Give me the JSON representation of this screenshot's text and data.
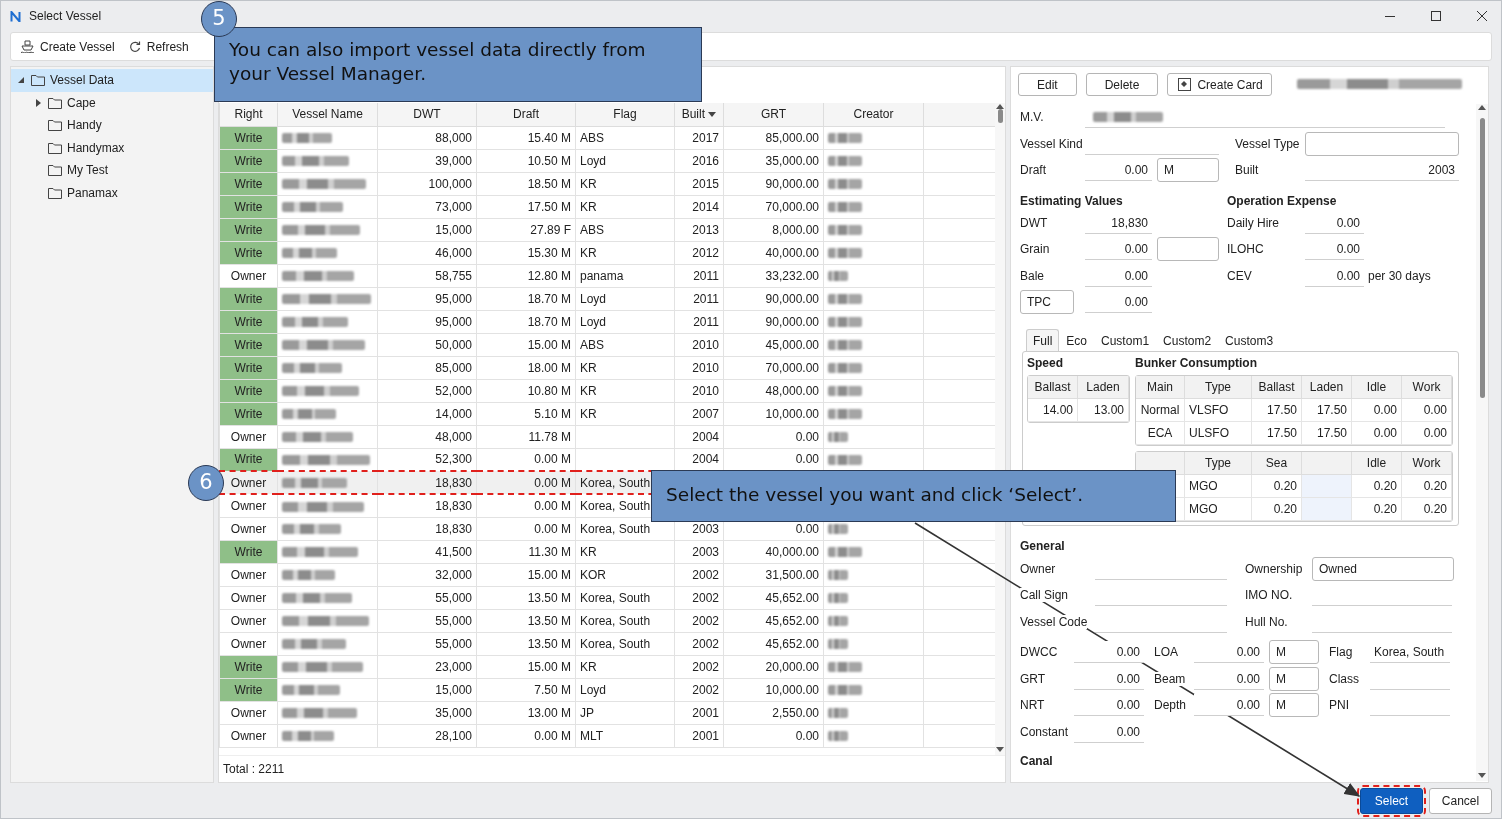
{
  "window": {
    "title": "Select Vessel"
  },
  "toolbar": [
    {
      "label": "Create Vessel",
      "kind": "ship"
    },
    {
      "label": "Refresh",
      "kind": "refresh"
    }
  ],
  "tree": [
    {
      "label": "Vessel Data",
      "selected": true,
      "expanded": true,
      "children": [
        {
          "label": "Cape",
          "selected": false,
          "expanded": false
        },
        {
          "label": "Handy",
          "selected": false
        },
        {
          "label": "Handymax",
          "selected": false
        },
        {
          "label": "My Test",
          "selected": false
        },
        {
          "label": "Panamax",
          "selected": false
        }
      ]
    }
  ],
  "table": {
    "columns": [
      {
        "label": "Right"
      },
      {
        "label": "Vessel Name"
      },
      {
        "label": "DWT"
      },
      {
        "label": "Draft"
      },
      {
        "label": "Flag"
      },
      {
        "label": "Built",
        "sorted": true
      },
      {
        "label": "GRT"
      },
      {
        "label": "Creator"
      }
    ],
    "rows": [
      {
        "right": "Write",
        "kind": "write",
        "dwt": "88,000",
        "draft": "15.40 M",
        "flag": "ABS",
        "built": "2017",
        "grt": "85,000.00",
        "selected": false
      },
      {
        "right": "Write",
        "kind": "write",
        "dwt": "39,000",
        "draft": "10.50 M",
        "flag": "Loyd",
        "built": "2016",
        "grt": "35,000.00",
        "selected": false
      },
      {
        "right": "Write",
        "kind": "write",
        "dwt": "100,000",
        "draft": "18.50 M",
        "flag": "KR",
        "built": "2015",
        "grt": "90,000.00",
        "selected": false
      },
      {
        "right": "Write",
        "kind": "write",
        "dwt": "73,000",
        "draft": "17.50 M",
        "flag": "KR",
        "built": "2014",
        "grt": "70,000.00",
        "selected": false
      },
      {
        "right": "Write",
        "kind": "write",
        "dwt": "15,000",
        "draft": "27.89 F",
        "flag": "ABS",
        "built": "2013",
        "grt": "8,000.00",
        "selected": false
      },
      {
        "right": "Write",
        "kind": "write",
        "dwt": "46,000",
        "draft": "15.30 M",
        "flag": "KR",
        "built": "2012",
        "grt": "40,000.00",
        "selected": false
      },
      {
        "right": "Owner",
        "kind": "owner",
        "dwt": "58,755",
        "draft": "12.80 M",
        "flag": "panama",
        "built": "2011",
        "grt": "33,232.00",
        "selected": false
      },
      {
        "right": "Write",
        "kind": "write",
        "dwt": "95,000",
        "draft": "18.70 M",
        "flag": "Loyd",
        "built": "2011",
        "grt": "90,000.00",
        "selected": false
      },
      {
        "right": "Write",
        "kind": "write",
        "dwt": "95,000",
        "draft": "18.70 M",
        "flag": "Loyd",
        "built": "2011",
        "grt": "90,000.00",
        "selected": false
      },
      {
        "right": "Write",
        "kind": "write",
        "dwt": "50,000",
        "draft": "15.00 M",
        "flag": "ABS",
        "built": "2010",
        "grt": "45,000.00",
        "selected": false
      },
      {
        "right": "Write",
        "kind": "write",
        "dwt": "85,000",
        "draft": "18.00 M",
        "flag": "KR",
        "built": "2010",
        "grt": "70,000.00",
        "selected": false
      },
      {
        "right": "Write",
        "kind": "write",
        "dwt": "52,000",
        "draft": "10.80 M",
        "flag": "KR",
        "built": "2010",
        "grt": "48,000.00",
        "selected": false
      },
      {
        "right": "Write",
        "kind": "write",
        "dwt": "14,000",
        "draft": "5.10 M",
        "flag": "KR",
        "built": "2007",
        "grt": "10,000.00",
        "selected": false
      },
      {
        "right": "Owner",
        "kind": "owner",
        "dwt": "48,000",
        "draft": "11.78 M",
        "built": "2004",
        "grt": "0.00",
        "selected": false
      },
      {
        "right": "Write",
        "kind": "write",
        "dwt": "52,300",
        "draft": "0.00 M",
        "built": "2004",
        "grt": "0.00",
        "selected": false
      },
      {
        "right": "Owner",
        "kind": "owner",
        "dwt": "18,830",
        "draft": "0.00 M",
        "flag": "Korea, South",
        "selected": true,
        "marked": true
      },
      {
        "right": "Owner",
        "kind": "owner",
        "dwt": "18,830",
        "draft": "0.00 M",
        "flag": "Korea, South",
        "selected": false
      },
      {
        "right": "Owner",
        "kind": "owner",
        "dwt": "18,830",
        "draft": "0.00 M",
        "flag": "Korea, South",
        "built": "2003",
        "grt": "0.00",
        "selected": false
      },
      {
        "right": "Write",
        "kind": "write",
        "dwt": "41,500",
        "draft": "11.30 M",
        "flag": "KR",
        "built": "2003",
        "grt": "40,000.00",
        "selected": false
      },
      {
        "right": "Owner",
        "kind": "owner",
        "dwt": "32,000",
        "draft": "15.00 M",
        "flag": "KOR",
        "built": "2002",
        "grt": "31,500.00",
        "selected": false
      },
      {
        "right": "Owner",
        "kind": "owner",
        "dwt": "55,000",
        "draft": "13.50 M",
        "flag": "Korea, South",
        "built": "2002",
        "grt": "45,652.00",
        "selected": false
      },
      {
        "right": "Owner",
        "kind": "owner",
        "dwt": "55,000",
        "draft": "13.50 M",
        "flag": "Korea, South",
        "built": "2002",
        "grt": "45,652.00",
        "selected": false
      },
      {
        "right": "Owner",
        "kind": "owner",
        "dwt": "55,000",
        "draft": "13.50 M",
        "flag": "Korea, South",
        "built": "2002",
        "grt": "45,652.00",
        "selected": false
      },
      {
        "right": "Write",
        "kind": "write",
        "dwt": "23,000",
        "draft": "15.00 M",
        "flag": "KR",
        "built": "2002",
        "grt": "20,000.00",
        "selected": false
      },
      {
        "right": "Write",
        "kind": "write",
        "dwt": "15,000",
        "draft": "7.50 M",
        "flag": "Loyd",
        "built": "2002",
        "grt": "10,000.00",
        "selected": false
      },
      {
        "right": "Owner",
        "kind": "owner",
        "dwt": "35,000",
        "draft": "13.00 M",
        "flag": "JP",
        "built": "2001",
        "grt": "2,550.00",
        "selected": false
      },
      {
        "right": "Owner",
        "kind": "owner",
        "dwt": "28,100",
        "draft": "0.00 M",
        "flag": "MLT",
        "built": "2001",
        "grt": "0.00",
        "selected": false
      }
    ],
    "total": "Total : 2211"
  },
  "detail": {
    "buttons": [
      {
        "label": "Edit"
      },
      {
        "label": "Delete"
      },
      {
        "label": "Create Card",
        "kind": "card"
      }
    ],
    "top_rows": [
      [
        {
          "kind": "label",
          "text": "M.V."
        },
        {
          "kind": "blur"
        }
      ],
      [
        {
          "kind": "label",
          "text": "Vessel Kind"
        },
        {
          "kind": "field"
        },
        {
          "kind": "label2",
          "text": "Vessel Type"
        },
        {
          "kind": "box2"
        }
      ],
      [
        {
          "kind": "label",
          "text": "Draft"
        },
        {
          "kind": "num",
          "value": "0.00"
        },
        {
          "kind": "unit",
          "value": "M"
        },
        {
          "kind": "label2",
          "text": "Built"
        },
        {
          "kind": "field2",
          "value": "2003"
        }
      ]
    ],
    "estimating": {
      "heading": "Estimating Values",
      "rows": [
        [
          {
            "kind": "label",
            "text": "DWT"
          },
          {
            "kind": "num",
            "value": "18,830"
          }
        ],
        [
          {
            "kind": "label",
            "text": "Grain"
          },
          {
            "kind": "num",
            "value": "0.00"
          },
          {
            "kind": "unit"
          }
        ],
        [
          {
            "kind": "label",
            "text": "Bale"
          },
          {
            "kind": "num",
            "value": "0.00"
          }
        ],
        [
          {
            "kind": "tag",
            "value": "TPC"
          },
          {
            "kind": "num",
            "value": "0.00"
          }
        ]
      ]
    },
    "expense": {
      "heading": "Operation Expense",
      "rows": [
        [
          {
            "kind": "label",
            "text": "Daily Hire"
          },
          {
            "kind": "num",
            "value": "0.00"
          }
        ],
        [
          {
            "kind": "label",
            "text": "ILOHC"
          },
          {
            "kind": "num",
            "value": "0.00"
          }
        ],
        [
          {
            "kind": "label",
            "text": "CEV"
          },
          {
            "kind": "num",
            "value": "0.00"
          },
          {
            "kind": "note",
            "text": "per 30 days"
          }
        ]
      ]
    },
    "consumption": {
      "tabs": [
        {
          "label": "Full",
          "selected": true
        },
        {
          "label": "Eco",
          "selected": false
        },
        {
          "label": "Custom1",
          "selected": false
        },
        {
          "label": "Custom2",
          "selected": false
        },
        {
          "label": "Custom3",
          "selected": false
        }
      ],
      "speed_heading": "Speed",
      "bunker_heading": "Bunker Consumption",
      "speed_table": {
        "columns": [
          "Ballast",
          "Laden"
        ],
        "rows": [
          [
            "14.00",
            "13.00"
          ]
        ]
      },
      "main_table": {
        "columns": [
          "Main",
          "Type",
          "Ballast",
          "Laden",
          "Idle",
          "Work"
        ],
        "rows": [
          [
            "Normal",
            "VLSFO",
            "17.50",
            "17.50",
            "0.00",
            "0.00"
          ],
          [
            "ECA",
            "ULSFO",
            "17.50",
            "17.50",
            "0.00",
            "0.00"
          ]
        ]
      },
      "sub_table": {
        "columns": [
          null,
          "Type",
          "Sea",
          null,
          "Idle",
          "Work"
        ],
        "rows": [
          [
            null,
            "MGO",
            "0.20",
            null,
            "0.20",
            "0.20"
          ],
          [
            null,
            "MGO",
            "0.20",
            null,
            "0.20",
            "0.20"
          ]
        ]
      }
    },
    "general": {
      "heading": "General",
      "rows": [
        [
          {
            "kind": "label",
            "text": "Owner"
          },
          {
            "kind": "field"
          },
          {
            "kind": "label2",
            "text": "Ownership"
          },
          {
            "kind": "box2",
            "value": "Owned"
          }
        ],
        [
          {
            "kind": "label",
            "text": "Call Sign"
          },
          {
            "kind": "field"
          },
          {
            "kind": "label2",
            "text": "IMO NO."
          },
          {
            "kind": "field2"
          }
        ],
        [
          {
            "kind": "label",
            "text": "Vessel Code"
          },
          {
            "kind": "field"
          },
          {
            "kind": "label2",
            "text": "Hull No."
          },
          {
            "kind": "field2"
          }
        ]
      ]
    },
    "measures": [
      [
        {
          "kind": "label",
          "text": "DWCC"
        },
        {
          "kind": "num",
          "value": "0.00"
        },
        {
          "kind": "label2",
          "text": "LOA"
        },
        {
          "kind": "num2",
          "value": "0.00"
        },
        {
          "kind": "unit",
          "value": "M"
        },
        {
          "kind": "label3",
          "text": "Flag"
        },
        {
          "kind": "field3",
          "value": "Korea, South"
        }
      ],
      [
        {
          "kind": "label",
          "text": "GRT"
        },
        {
          "kind": "num",
          "value": "0.00"
        },
        {
          "kind": "label2",
          "text": "Beam"
        },
        {
          "kind": "num2",
          "value": "0.00"
        },
        {
          "kind": "unit",
          "value": "M"
        },
        {
          "kind": "label3",
          "text": "Class"
        },
        {
          "kind": "field3"
        }
      ],
      [
        {
          "kind": "label",
          "text": "NRT"
        },
        {
          "kind": "num",
          "value": "0.00"
        },
        {
          "kind": "label2",
          "text": "Depth"
        },
        {
          "kind": "num2",
          "value": "0.00"
        },
        {
          "kind": "unit",
          "value": "M"
        },
        {
          "kind": "label3",
          "text": "PNI"
        },
        {
          "kind": "field3"
        }
      ],
      [
        {
          "kind": "label",
          "text": "Constant"
        },
        {
          "kind": "num",
          "value": "0.00"
        }
      ]
    ],
    "canal": {
      "heading": "Canal"
    }
  },
  "footer_buttons": [
    {
      "label": "Select",
      "primary": true,
      "marked": true
    },
    {
      "label": "Cancel",
      "primary": false,
      "marked": false
    }
  ],
  "callouts": [
    {
      "number": "5",
      "text": "You can also import vessel data directly from your Vessel Manager."
    },
    {
      "number": "6",
      "text": "Select the vessel you want and click ‘Select’."
    }
  ]
}
